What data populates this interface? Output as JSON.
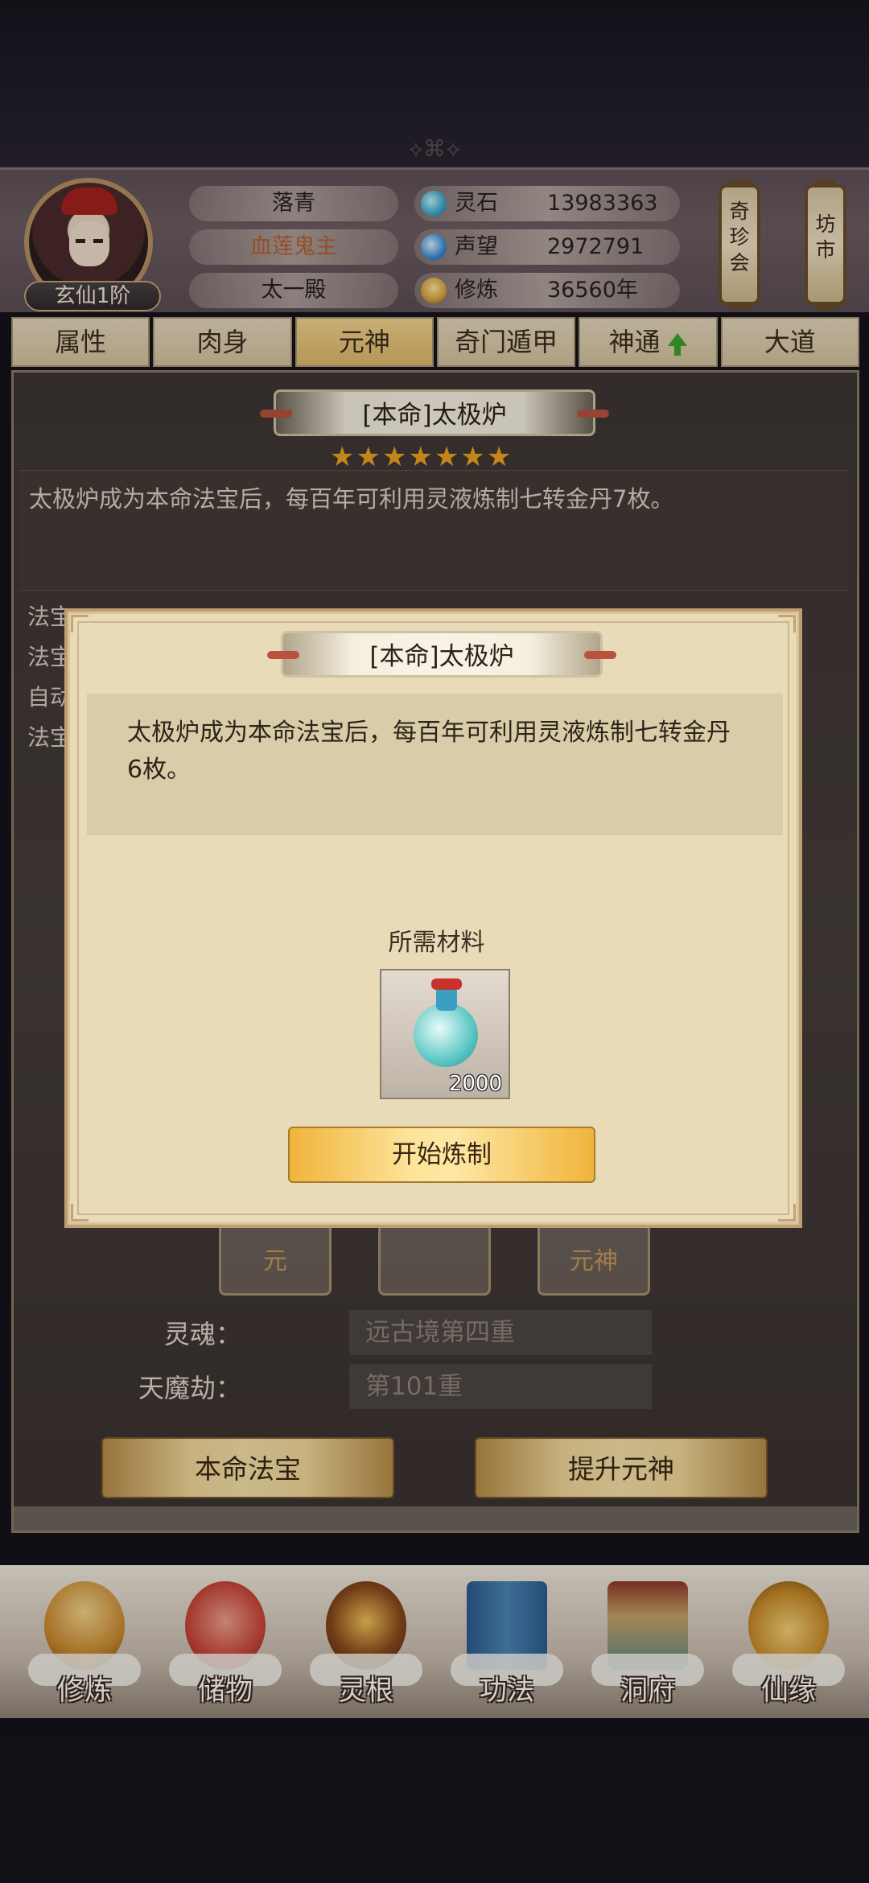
{
  "header": {
    "rank_badge": "玄仙1阶",
    "name": "落青",
    "title": "血莲鬼主",
    "sect": "太一殿",
    "stats": [
      {
        "icon": "spirit-stone-icon",
        "label": "灵石",
        "value": "13983363"
      },
      {
        "icon": "reputation-icon",
        "label": "声望",
        "value": "2972791"
      },
      {
        "icon": "cultivation-icon",
        "label": "修炼",
        "value": "36560年"
      }
    ],
    "side_buttons": [
      "奇珍会",
      "坊市"
    ]
  },
  "tabs": [
    {
      "label": "属性"
    },
    {
      "label": "肉身"
    },
    {
      "label": "元神",
      "active": true
    },
    {
      "label": "奇门遁甲"
    },
    {
      "label": "神通",
      "upgrade_icon": "green-up-arrow-icon"
    },
    {
      "label": "大道"
    }
  ],
  "background_panel": {
    "treasure_title": "[本命]太极炉",
    "stars": 7,
    "stars_text": "★★★★★★★",
    "description": "太极炉成为本命法宝后，每百年可利用灵液炼制七转金丹7枚。",
    "partial_labels": [
      "法宝",
      "法宝",
      "自动",
      "法宝"
    ],
    "slot_yuanshen_label": "元神",
    "slot_partial": "元",
    "soul_label": "灵魂：",
    "soul_value": "远古境第四重",
    "demon_label": "天魔劫：",
    "demon_value": "第101重",
    "btn_natal_treasure": "本命法宝",
    "btn_upgrade_spirit": "提升元神"
  },
  "dialog": {
    "title": "[本命]太极炉",
    "description": "太极炉成为本命法宝后，每百年可利用灵液炼制七转金丹6枚。",
    "required_label": "所需材料",
    "material": {
      "icon": "spirit-liquid-bottle-icon",
      "quantity": "2000"
    },
    "start_button": "开始炼制"
  },
  "bottom_nav": [
    {
      "label": "修炼",
      "icon": "meditation-icon"
    },
    {
      "label": "储物",
      "icon": "storage-bag-icon"
    },
    {
      "label": "灵根",
      "icon": "spirit-root-icon"
    },
    {
      "label": "功法",
      "icon": "scripture-book-icon"
    },
    {
      "label": "洞府",
      "icon": "cave-dwelling-icon"
    },
    {
      "label": "仙缘",
      "icon": "gourd-icon"
    }
  ],
  "colors": {
    "gold_button": "#f7e2a8",
    "dialog_bg": "#e9dbb8",
    "star": "#f0a420",
    "title_orange": "#b86030",
    "upgrade_green": "#3aa52c"
  }
}
